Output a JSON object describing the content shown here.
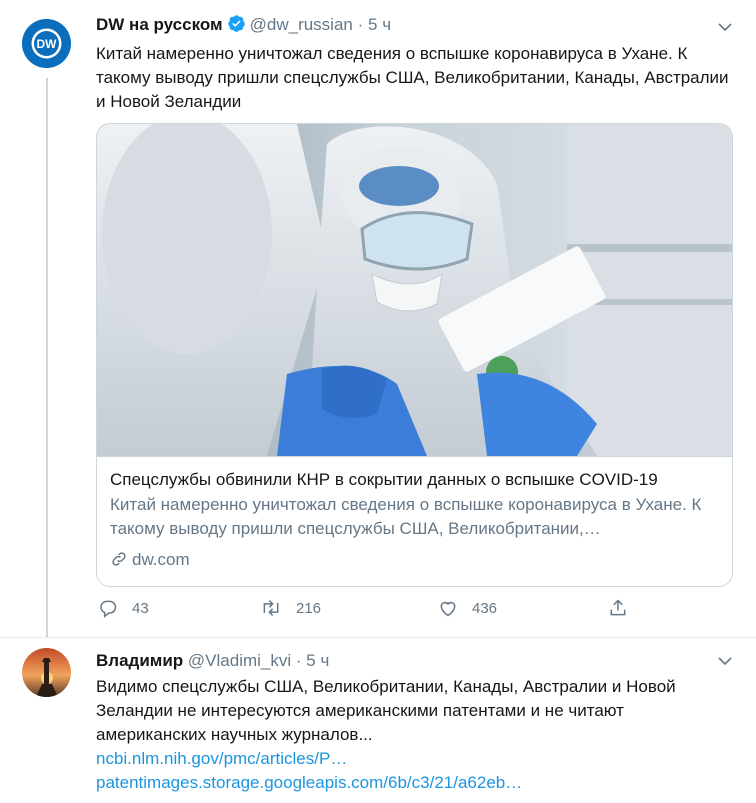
{
  "tweet1": {
    "author_name": "DW на русском",
    "handle": "@dw_russian",
    "dot": "·",
    "time": "5 ч",
    "avatar_text": "DW",
    "text": "Китай намеренно уничтожал сведения о вспышке коронавируса в Ухане. К такому выводу пришли спецслужбы США, Великобритании, Канады, Австралии и Новой Зеландии",
    "card": {
      "title": "Спецслужбы обвинили КНР в сокрытии данных о вспышке COVID-19",
      "description": "Китай намеренно уничтожал сведения о вспышке коронавируса в Ухане. К такому выводу пришли спецслужбы США, Великобритании,…",
      "domain": "dw.com"
    },
    "actions": {
      "replies": "43",
      "retweets": "216",
      "likes": "436"
    }
  },
  "tweet2": {
    "author_name": "Владимир",
    "handle": "@Vladimi_kvi",
    "dot": "·",
    "time": "5 ч",
    "text": "Видимо спецслужбы США, Великобритании, Канады, Австралии и Новой Зеландии не интересуются американскими патентами и не читают американских научных журналов...",
    "links": [
      "ncbi.nlm.nih.gov/pmc/articles/P…",
      "patentimages.storage.googleapis.com/6b/c3/21/a62eb…"
    ]
  },
  "colors": {
    "accent": "#1da1f2",
    "link": "#1b95e0",
    "muted": "#657786",
    "dw_blue": "#0a6ebd"
  },
  "icons": [
    "verified-icon",
    "chevron-down-icon",
    "reply-icon",
    "retweet-icon",
    "like-icon",
    "share-icon",
    "link-icon"
  ]
}
